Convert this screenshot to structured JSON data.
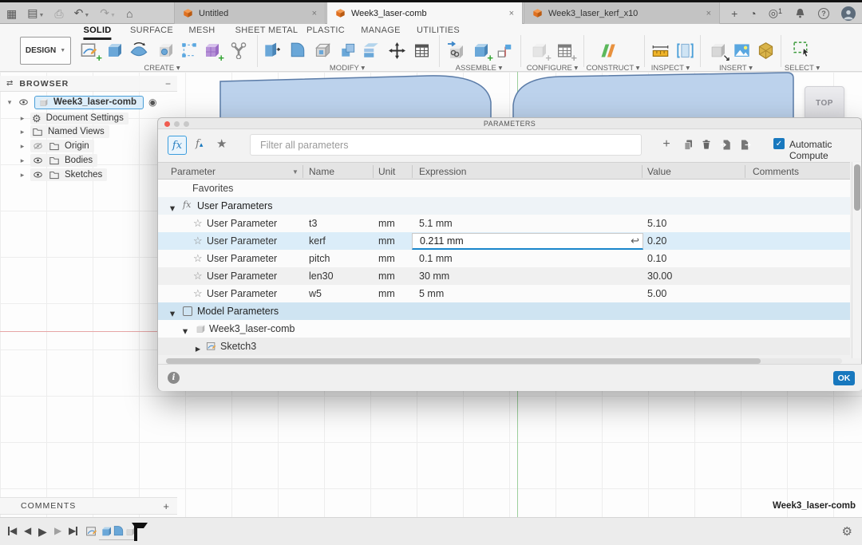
{
  "colors": {
    "accent": "#1878be",
    "row_highlight": "#dbedf9",
    "cube_orange": "#e8832e",
    "ok_button": "#1878be"
  },
  "titlebar": {
    "tabs": [
      {
        "label": "Untitled",
        "active": false
      },
      {
        "label": "Week3_laser-comb",
        "active": true
      },
      {
        "label": "Week3_laser_kerf_x10",
        "active": false
      }
    ],
    "notification_count": "1"
  },
  "ribbon": {
    "design_label": "DESIGN",
    "tabs": [
      {
        "label": "SOLID",
        "active": true
      },
      {
        "label": "SURFACE",
        "active": false
      },
      {
        "label": "MESH",
        "active": false
      },
      {
        "label": "SHEET METAL",
        "active": false
      },
      {
        "label": "PLASTIC",
        "active": false
      },
      {
        "label": "MANAGE",
        "active": false
      },
      {
        "label": "UTILITIES",
        "active": false
      }
    ],
    "groups": {
      "create": "CREATE",
      "modify": "MODIFY",
      "assemble": "ASSEMBLE",
      "configure": "CONFIGURE",
      "construct": "CONSTRUCT",
      "inspect": "INSPECT",
      "insert": "INSERT",
      "select": "SELECT"
    }
  },
  "browser": {
    "title": "BROWSER",
    "root_label": "Week3_laser-comb",
    "items": [
      {
        "label": "Document Settings"
      },
      {
        "label": "Named Views"
      },
      {
        "label": "Origin"
      },
      {
        "label": "Bodies"
      },
      {
        "label": "Sketches"
      }
    ]
  },
  "canvas": {
    "viewcube_label": "TOP"
  },
  "dialog": {
    "title": "PARAMETERS",
    "filter_placeholder": "Filter all parameters",
    "auto_compute_label": "Automatic Compute",
    "columns": {
      "parameter": "Parameter",
      "name": "Name",
      "unit": "Unit",
      "expression": "Expression",
      "value": "Value",
      "comments": "Comments"
    },
    "favorites_label": "Favorites",
    "user_params_label": "User Parameters",
    "rows": [
      {
        "parameter": "User Parameter",
        "name": "t3",
        "unit": "mm",
        "expression": "5.1 mm",
        "value": "5.10"
      },
      {
        "parameter": "User Parameter",
        "name": "kerf",
        "unit": "mm",
        "expression": "0.211 mm",
        "value": "0.20"
      },
      {
        "parameter": "User Parameter",
        "name": "pitch",
        "unit": "mm",
        "expression": "0.1 mm",
        "value": "0.10"
      },
      {
        "parameter": "User Parameter",
        "name": "len30",
        "unit": "mm",
        "expression": "30 mm",
        "value": "30.00"
      },
      {
        "parameter": "User Parameter",
        "name": "w5",
        "unit": "mm",
        "expression": "5 mm",
        "value": "5.00"
      }
    ],
    "model_params_label": "Model Parameters",
    "model_component_label": "Week3_laser-comb",
    "model_sketch_label": "Sketch3",
    "ok_label": "OK"
  },
  "bottom": {
    "comments_label": "COMMENTS",
    "document_label": "Week3_laser-comb"
  }
}
